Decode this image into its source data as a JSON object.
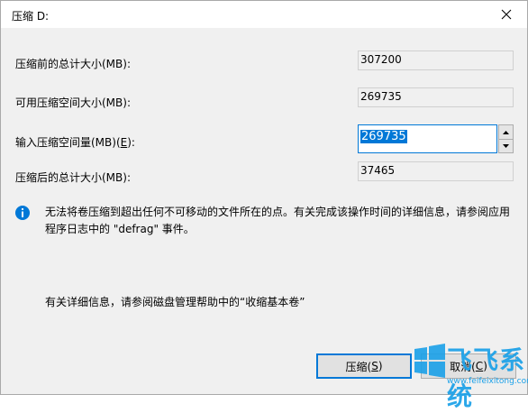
{
  "window": {
    "title": "压缩 D:"
  },
  "fields": {
    "total_before": {
      "label": "压缩前的总计大小(MB):",
      "value": "307200"
    },
    "available": {
      "label": "可用压缩空间大小(MB):",
      "value": "269735"
    },
    "amount": {
      "label_prefix": "输入压缩空间量(MB)(",
      "label_key": "E",
      "label_suffix": "):",
      "value": "269735"
    },
    "total_after": {
      "label": "压缩后的总计大小(MB):",
      "value": "37465"
    }
  },
  "message": "无法将卷压缩到超出任何不可移动的文件所在的点。有关完成该操作时间的详细信息，请参阅应用程序日志中的 \"defrag\" 事件。",
  "note": "有关详细信息，请参阅磁盘管理帮助中的“收缩基本卷”",
  "buttons": {
    "shrink": {
      "prefix": "压缩(",
      "key": "S",
      "suffix": ")"
    },
    "cancel": {
      "prefix": "取消(",
      "key": "C",
      "suffix": ")"
    }
  },
  "watermark": {
    "text": "飞飞系统",
    "url": "www.feifeixitong.com"
  },
  "colors": {
    "accent": "#0078d7",
    "info": "#0078d7",
    "watermark": "#1aa0e8"
  },
  "icons": [
    "close-icon",
    "info-icon",
    "spin-up-icon",
    "spin-down-icon",
    "windows-logo-icon"
  ]
}
